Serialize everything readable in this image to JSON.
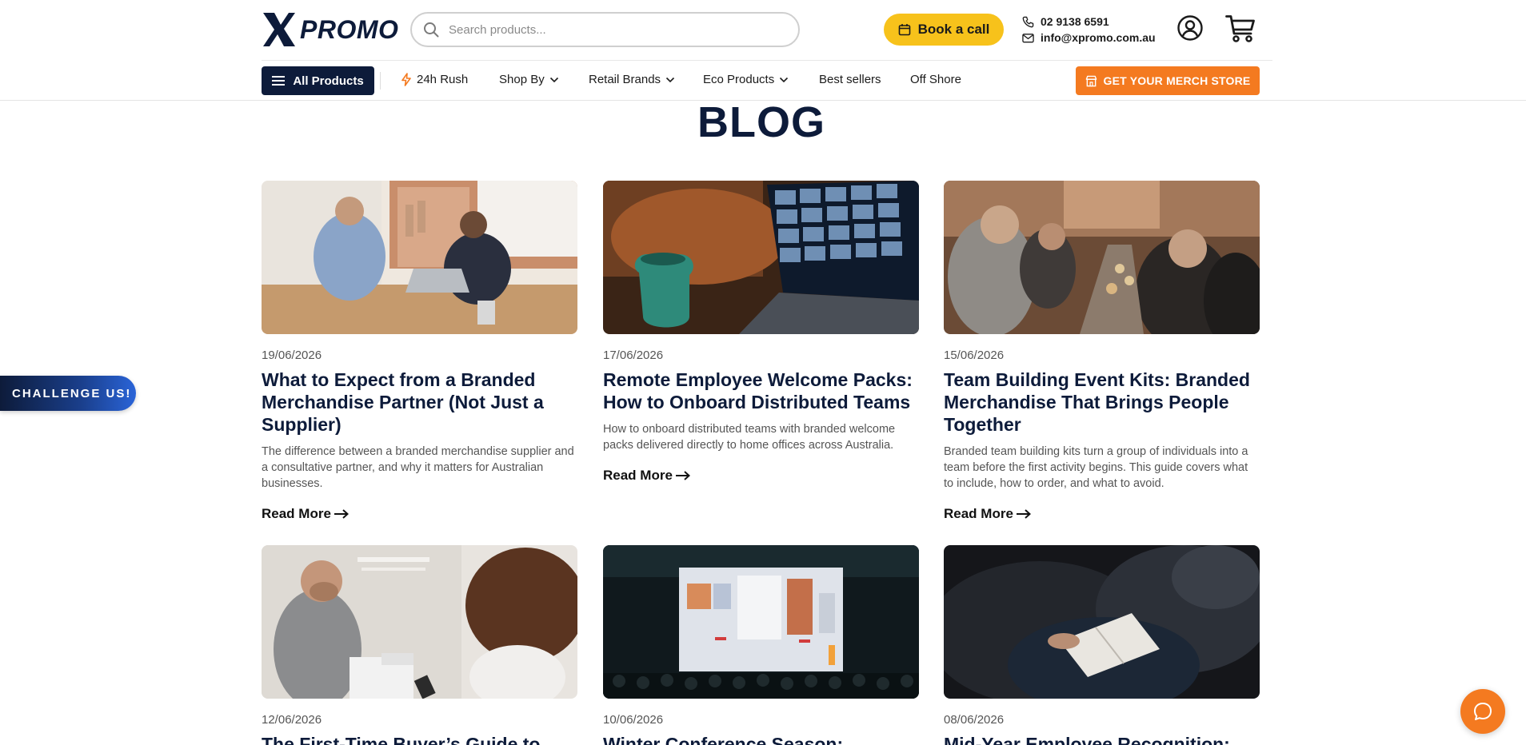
{
  "header": {
    "logo_text": "PROMO",
    "search": {
      "placeholder": "Search products..."
    },
    "book_call_label": "Book a call",
    "phone": "02 9138 6591",
    "email": "info@xpromo.com.au"
  },
  "nav": {
    "all_products": "All Products",
    "items": [
      {
        "label": "24h Rush"
      },
      {
        "label": "Shop By"
      },
      {
        "label": "Retail Brands"
      },
      {
        "label": "Eco Products"
      },
      {
        "label": "Best sellers"
      },
      {
        "label": "Off Shore"
      }
    ],
    "merch_store": "GET YOUR MERCH STORE"
  },
  "page": {
    "title": "BLOG"
  },
  "posts": [
    {
      "date": "19/06/2026",
      "title": "What to Expect from a Branded Merchandise Partner (Not Just a Supplier)",
      "desc": "The difference between a branded merchandise supplier and a consultative partner, and why it matters for Australian businesses.",
      "more": "Read More"
    },
    {
      "date": "17/06/2026",
      "title": "Remote Employee Welcome Packs: How to Onboard Distributed Teams",
      "desc": "How to onboard distributed teams with branded welcome packs delivered directly to home offices across Australia.",
      "more": "Read More"
    },
    {
      "date": "15/06/2026",
      "title": "Team Building Event Kits: Branded Merchandise That Brings People Together",
      "desc": "Branded team building kits turn a group of individuals into a team before the first activity begins. This guide covers what to include, how to order, and what to avoid.",
      "more": "Read More"
    },
    {
      "date": "12/06/2026",
      "title": "The First-Time Buyer’s Guide to"
    },
    {
      "date": "10/06/2026",
      "title": "Winter Conference Season: Branded"
    },
    {
      "date": "08/06/2026",
      "title": "Mid-Year Employee Recognition: Why"
    }
  ],
  "floating": {
    "challenge": "CHALLENGE US!"
  },
  "colors": {
    "navy": "#0d1b3a",
    "yellow": "#f7c21b",
    "orange": "#f47a20"
  }
}
